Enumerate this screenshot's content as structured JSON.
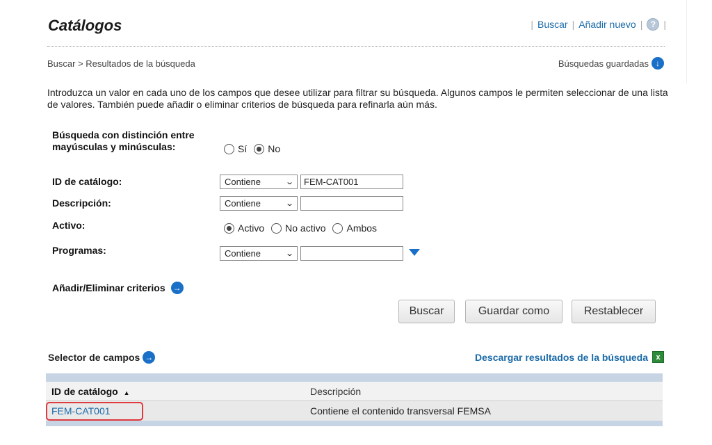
{
  "header": {
    "title": "Catálogos",
    "links": {
      "search": "Buscar",
      "add_new": "Añadir nuevo"
    },
    "help_icon": "help-icon"
  },
  "breadcrumb": "Buscar > Resultados de la búsqueda",
  "saved_searches": "Búsquedas guardadas",
  "intro": "Introduzca un valor en cada uno de los campos que desee utilizar para filtrar su búsqueda. Algunos campos le permiten seleccionar de una lista de valores. También puede añadir o eliminar criterios de búsqueda para refinarla aún más.",
  "form": {
    "case_sensitive": {
      "label": "Búsqueda con distinción entre mayúsculas y minúsculas:",
      "options": [
        "Sí",
        "No"
      ],
      "selected": "No"
    },
    "catalog_id": {
      "label": "ID de catálogo:",
      "operator": "Contiene",
      "value": "FEM-CAT001"
    },
    "description": {
      "label": "Descripción:",
      "operator": "Contiene",
      "value": ""
    },
    "active": {
      "label": "Activo:",
      "options": [
        "Activo",
        "No activo",
        "Ambos"
      ],
      "selected": "Activo"
    },
    "programs": {
      "label": "Programas:",
      "operator": "Contiene",
      "value": ""
    },
    "add_remove_criteria": "Añadir/Eliminar criterios"
  },
  "buttons": {
    "search": "Buscar",
    "save_as": "Guardar como",
    "reset": "Restablecer"
  },
  "field_selector": "Selector de campos",
  "download_results": "Descargar resultados de la búsqueda",
  "results": {
    "columns": [
      "ID de catálogo",
      "Descripción"
    ],
    "rows": [
      {
        "id": "FEM-CAT001",
        "description": "Contiene el contenido transversal FEMSA"
      }
    ]
  },
  "colors": {
    "link": "#1a6aa8",
    "accent": "#1a6fc7",
    "highlight": "#e0393e",
    "table_band": "#c6d4e4"
  }
}
